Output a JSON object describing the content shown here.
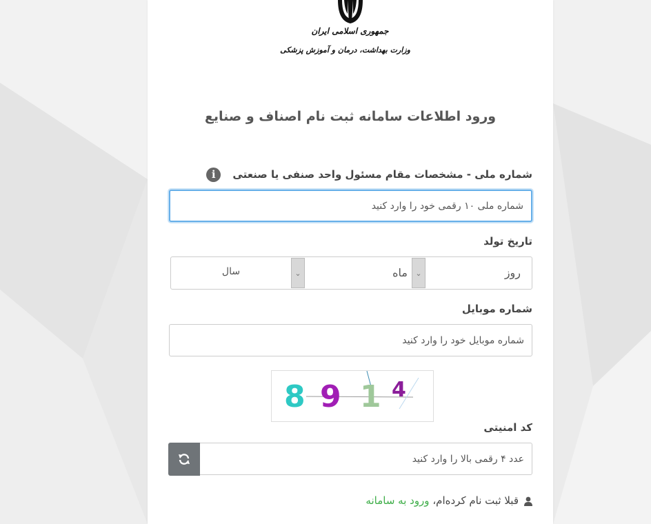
{
  "logo": {
    "line1": "جمهوری اسلامی ایران",
    "line2": "وزارت بهداشت، درمان و آموزش پزشکی"
  },
  "title": "ورود اطلاعات سامانه ثبت نام اصناف و صنایع",
  "national_id": {
    "label": "شماره ملی - مشخصات مقام مسئول واحد صنفی یا صنعتی",
    "icon": "info-icon",
    "placeholder": "شماره ملی ۱۰ رقمی خود را وارد کنید"
  },
  "birth_date": {
    "label": "تاریخ تولد",
    "day": "روز",
    "month": "ماه",
    "year": "سال"
  },
  "mobile": {
    "label": "شماره موبایل",
    "placeholder": "شماره موبایل خود را وارد کنید"
  },
  "captcha": {
    "digits": [
      "8",
      "9",
      "1",
      "4"
    ],
    "label": "کد امنیتی",
    "placeholder": "عدد ۴ رقمی بالا را وارد کنید",
    "refresh_icon": "refresh-icon"
  },
  "footer": {
    "text": "قبلا ثبت نام کرده‌ام،",
    "link": "ورود به سامانه",
    "icon": "user-icon"
  },
  "colors": {
    "link": "#3fae49",
    "focus_border": "#66afe9",
    "button": "#6f7478"
  }
}
